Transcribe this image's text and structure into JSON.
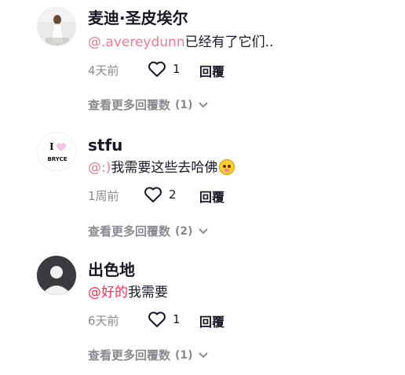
{
  "comments": [
    {
      "name": "麦迪·圣皮埃尔",
      "mention": "@.avereydunn",
      "text": "已经有了它们..",
      "time": "4天前",
      "likes": "1",
      "reply": "回覆",
      "more_label": "查看更多回覆数",
      "more_count": "(1)"
    },
    {
      "name": "stfu",
      "mention": "@:)",
      "text": "我需要这些去哈佛",
      "avatar_text_top": "I",
      "avatar_text_bottom": "BRYCE",
      "time": "1周前",
      "likes": "2",
      "reply": "回覆",
      "more_label": "查看更多回覆数",
      "more_count": "(2)"
    },
    {
      "name": "出色地",
      "mention": "@好的",
      "text": "我需要",
      "time": "6天前",
      "likes": "1",
      "reply": "回覆",
      "more_label": "查看更多回覆数",
      "more_count": "(1)"
    }
  ],
  "icons": {
    "like": "heart-outline-icon",
    "expand": "chevron-down-icon",
    "emoji": "pleading-face-emoji"
  },
  "colors": {
    "mention": "#fe2c55",
    "secondary_text": "#8a8b91",
    "primary_text": "#161823"
  }
}
